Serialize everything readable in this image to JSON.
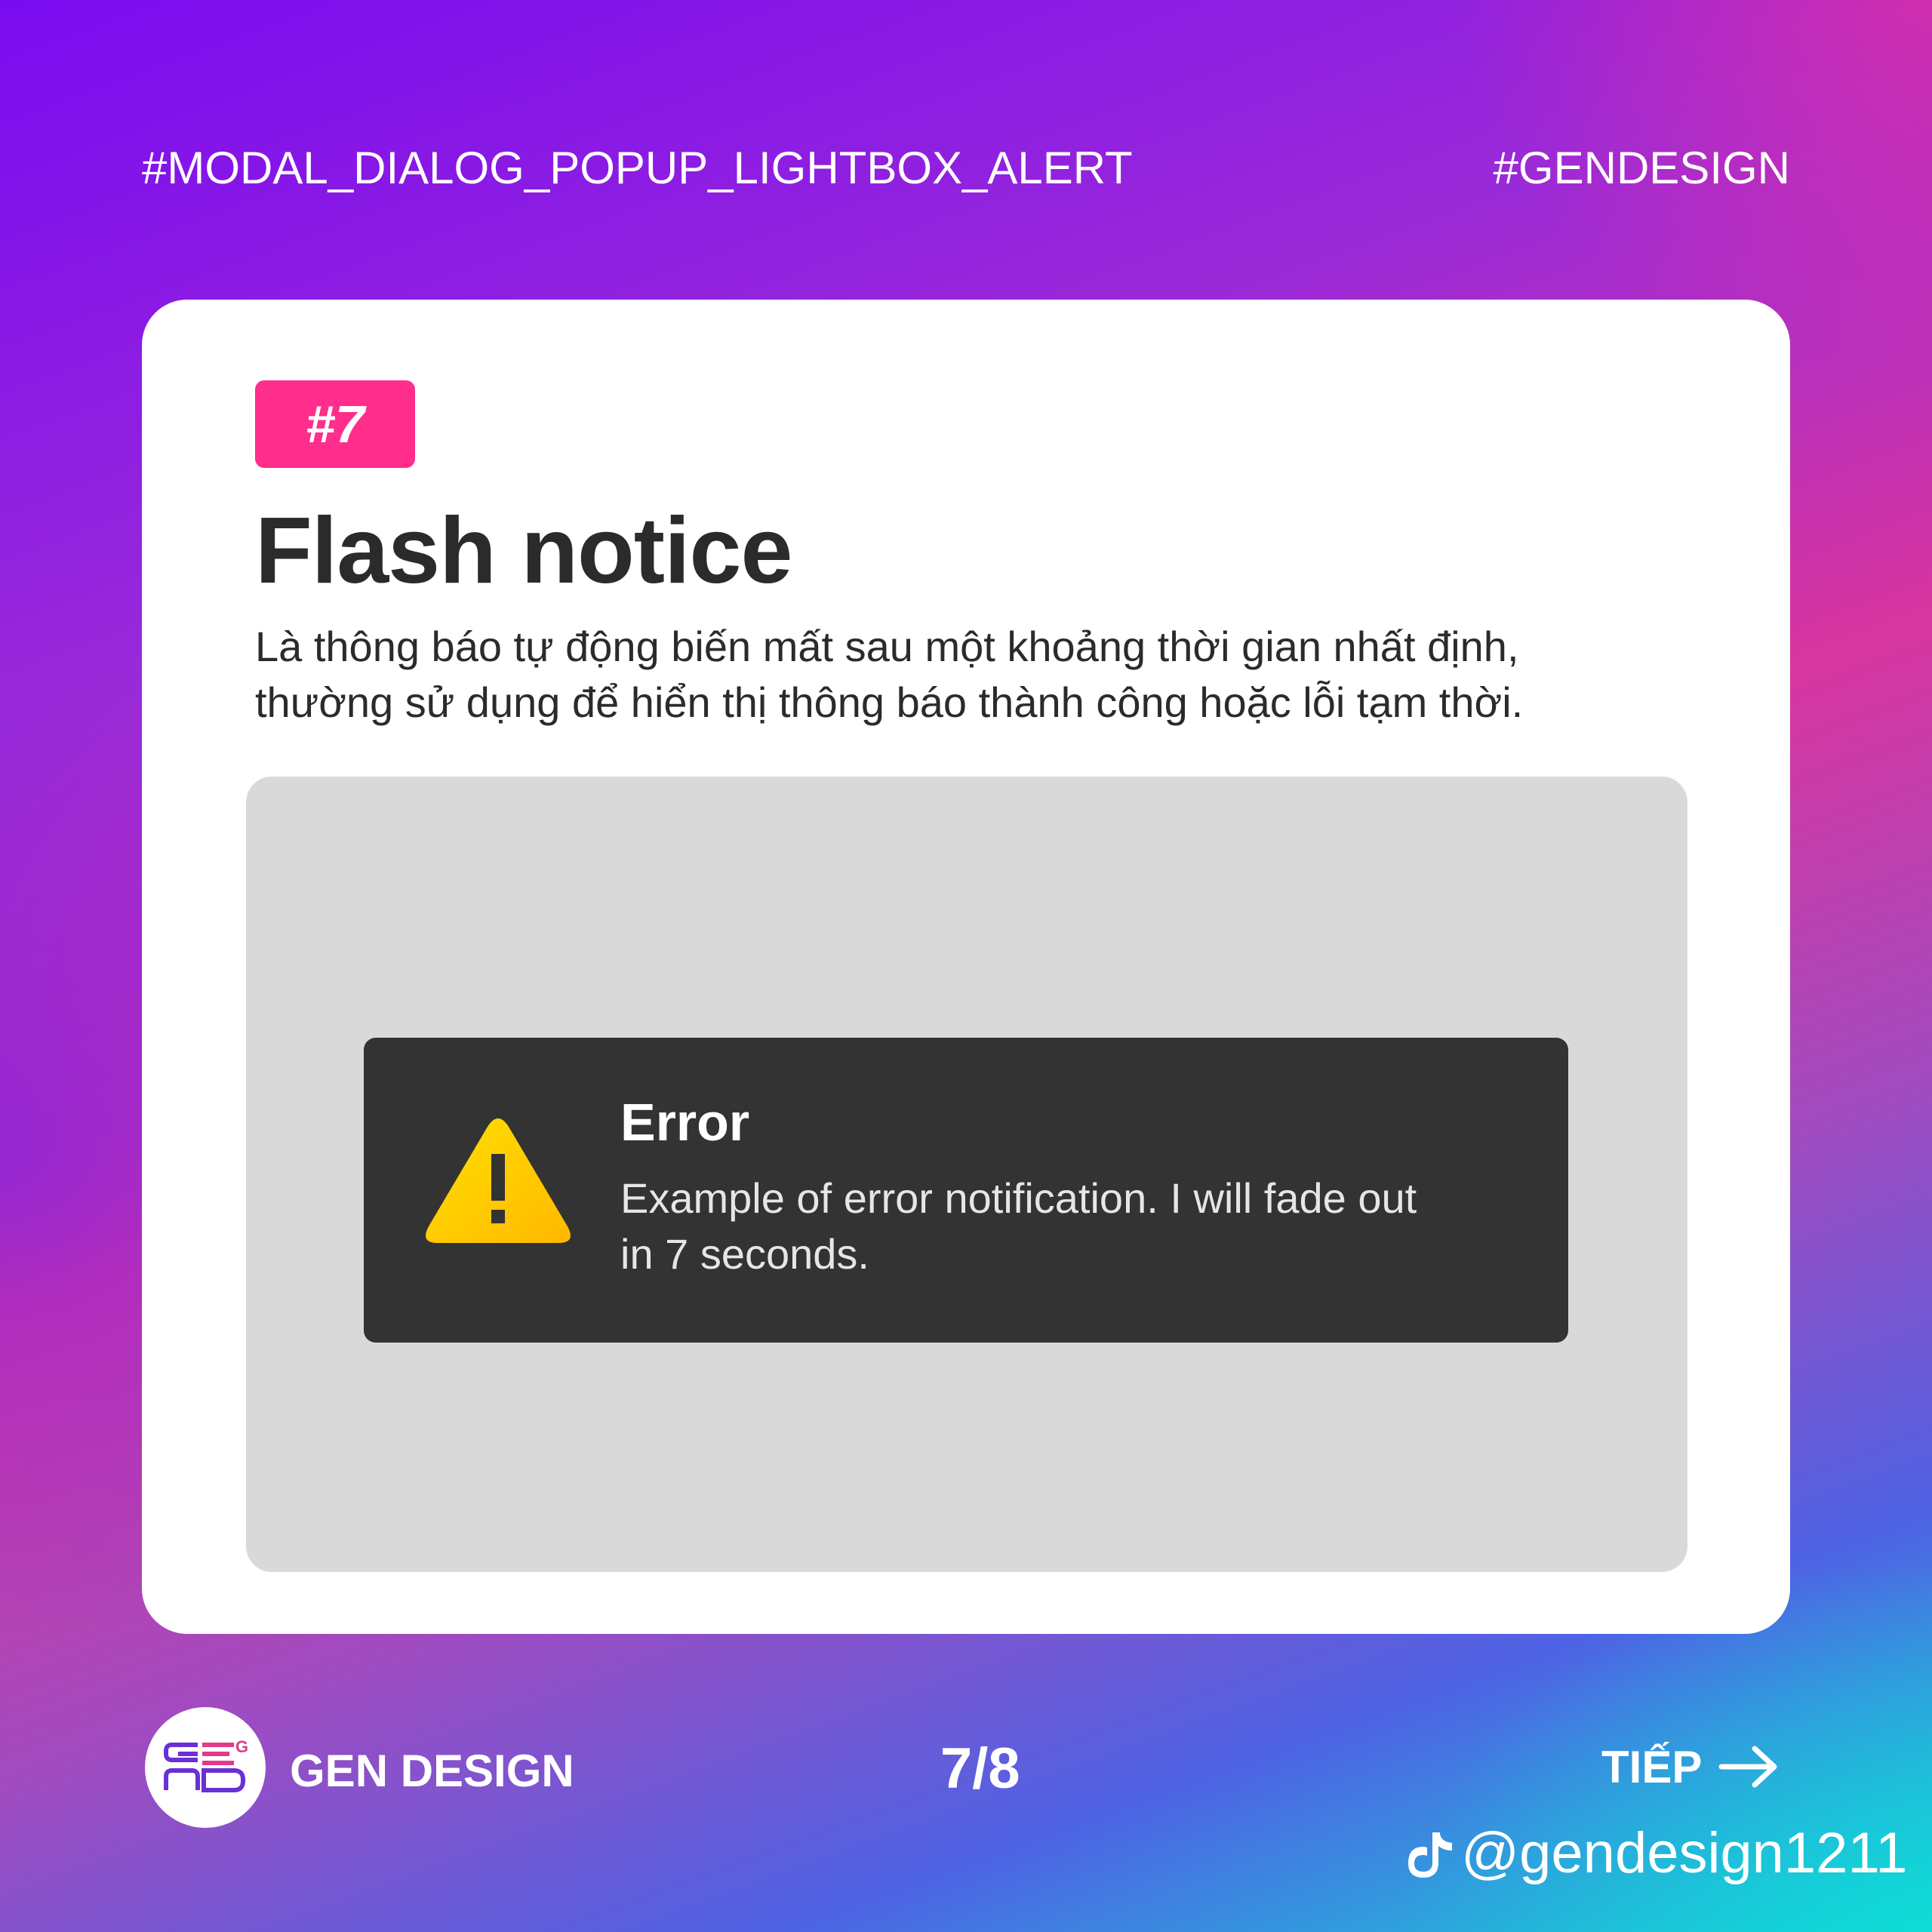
{
  "header": {
    "topic_tag": "#MODAL_DIALOG_POPUP_LIGHTBOX_ALERT",
    "brand_tag": "#GENDESIGN"
  },
  "card": {
    "badge": "#7",
    "title": "Flash notice",
    "description_lines": [
      "Là thông báo tự động biến mất sau một khoảng thời gian nhất định,",
      "thường sử dụng để hiển thị thông báo thành công hoặc lỗi tạm thời."
    ]
  },
  "toast": {
    "icon": "warning-triangle-icon",
    "title": "Error",
    "message_lines": [
      "Example of error notification. I will fade out",
      "in 7 seconds."
    ]
  },
  "footer": {
    "logo_text": "GEN",
    "brand_name": "GEN DESIGN",
    "page_indicator": "7/8",
    "next_label": "TIẾP",
    "next_icon": "arrow-right-icon",
    "social_icon": "tiktok-icon",
    "social_handle": "@gendesign1211"
  },
  "colors": {
    "badge": "#ff2e8c",
    "toast_bg": "#333333",
    "warning_yellow": "#ffd000",
    "preview_bg": "#d9d9d9"
  }
}
